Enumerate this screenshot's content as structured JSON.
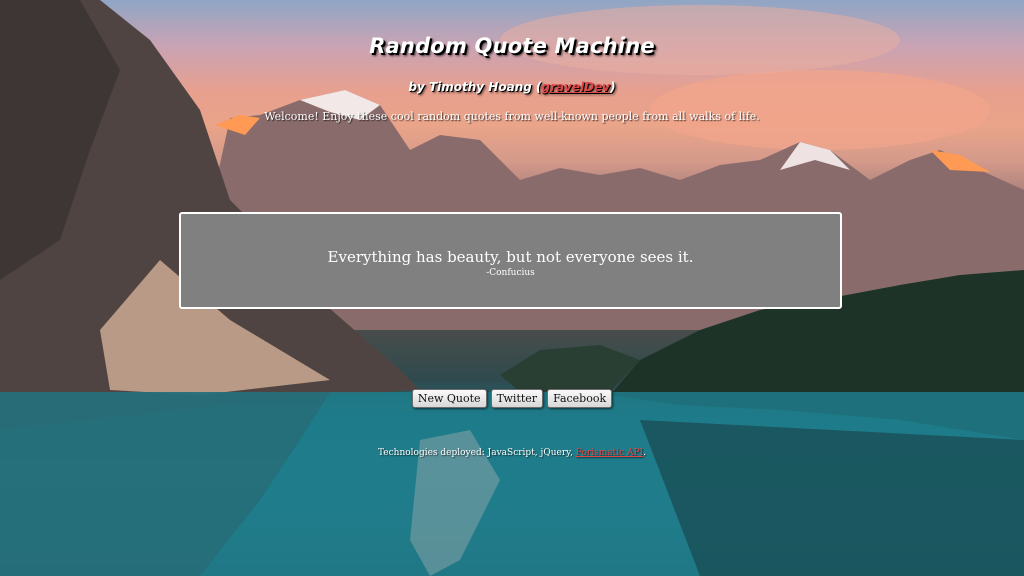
{
  "header": {
    "title": "Random Quote Machine",
    "byline_prefix": "by Timothy Hoang (",
    "byline_link": "gravelDev",
    "byline_suffix": ")",
    "welcome": "Welcome! Enjoy these cool random quotes from well-known people from all walks of life."
  },
  "quote": {
    "text": "Everything has beauty, but not everyone sees it.",
    "author": "-Confucius"
  },
  "actions": {
    "new_quote": "New Quote",
    "twitter": "Twitter",
    "facebook": "Facebook"
  },
  "footer": {
    "tech_prefix": "Technologies deployed: JavaScript, jQuery, ",
    "tech_link": "Forismatic API",
    "tech_suffix": "."
  },
  "colors": {
    "link": "#e04848",
    "quote_box": "#808080"
  }
}
